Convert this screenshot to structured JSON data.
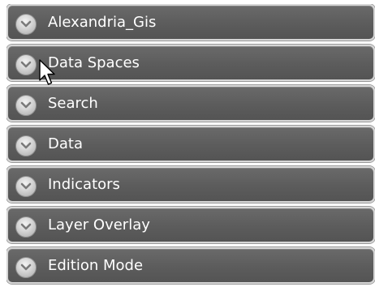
{
  "accordion": {
    "items": [
      {
        "label": "Alexandria_Gis",
        "icon": "chevron-down-icon"
      },
      {
        "label": "Data Spaces",
        "icon": "chevron-down-icon"
      },
      {
        "label": "Search",
        "icon": "chevron-down-icon"
      },
      {
        "label": "Data",
        "icon": "chevron-down-icon"
      },
      {
        "label": "Indicators",
        "icon": "chevron-down-icon"
      },
      {
        "label": "Layer Overlay",
        "icon": "chevron-down-icon"
      },
      {
        "label": "Edition Mode",
        "icon": "chevron-down-icon"
      }
    ]
  },
  "colors": {
    "panel_background": "#5c5c5c",
    "panel_border": "#d6d6d6",
    "label_text": "#ffffff",
    "expander_button": "#d4d4d4",
    "chevron": "#7a7a7a"
  },
  "cursor": {
    "icon": "mouse-pointer-icon"
  }
}
